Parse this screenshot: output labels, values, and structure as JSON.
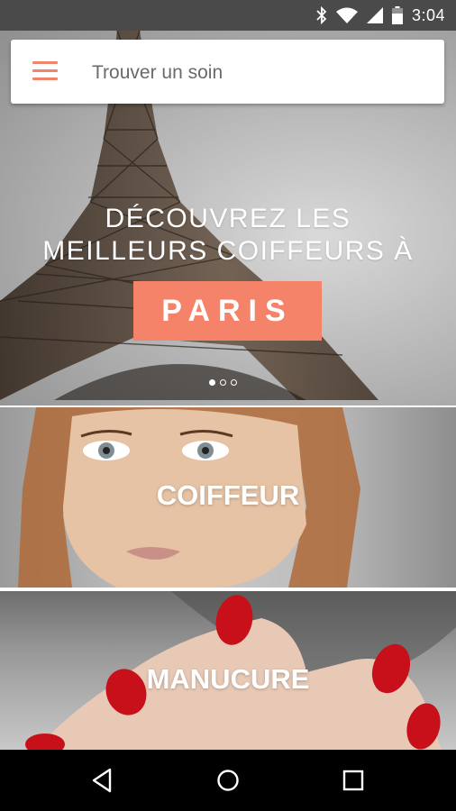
{
  "status_bar": {
    "time": "3:04",
    "icons": [
      "bluetooth-icon",
      "wifi-icon",
      "signal-icon",
      "battery-icon"
    ]
  },
  "search": {
    "placeholder": "Trouver un soin",
    "menu_icon": "hamburger-menu-icon",
    "accent_color": "#f0836b"
  },
  "hero": {
    "line1": "DÉCOUVREZ LES",
    "line2": "MEILLEURS COIFFEURS À",
    "city": "PARIS",
    "city_box_color": "#f5836a",
    "carousel": {
      "total": 3,
      "active": 1
    }
  },
  "categories": [
    {
      "label": "COIFFEUR"
    },
    {
      "label": "MANUCURE"
    }
  ],
  "nav_bar": {
    "buttons": [
      "back-icon",
      "home-icon",
      "recents-icon"
    ]
  }
}
